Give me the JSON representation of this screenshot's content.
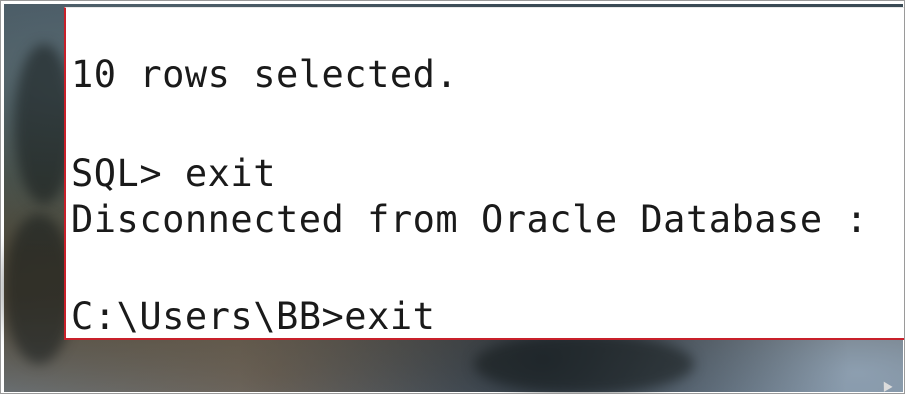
{
  "console": {
    "lines": [
      "10 rows selected.",
      "SQL> exit",
      "Disconnected from Oracle Database :",
      "C:\\Users\\BB>exit"
    ]
  },
  "colors": {
    "console_border": "#c8202a",
    "console_text": "#1a1a1a",
    "console_background": "#ffffff"
  },
  "icons": {
    "mouse_pointer": "mouse-pointer-icon"
  }
}
